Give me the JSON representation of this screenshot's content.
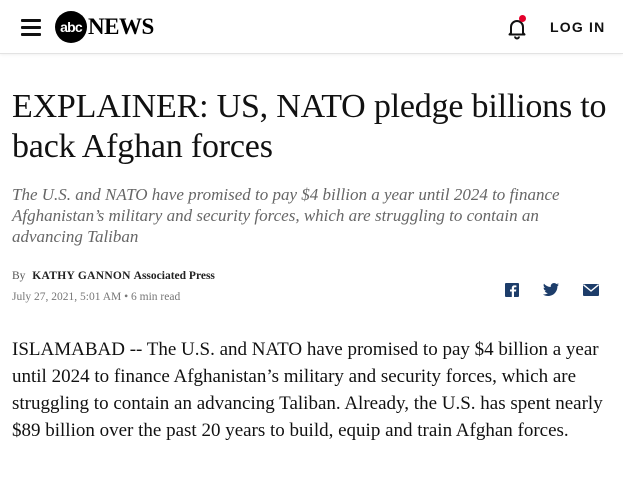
{
  "header": {
    "logo_abc": "abc",
    "logo_news": "NEWS",
    "login_label": "LOG IN",
    "notification_dot_color": "#e4002b"
  },
  "article": {
    "headline": "EXPLAINER: US, NATO pledge billions to back Afghan forces",
    "subhead": "The U.S. and NATO have promised to pay $4 billion a year until 2024 to finance Afghanistan’s military and security forces, which are struggling to contain an advancing Taliban",
    "byline_prefix": "By",
    "author": "KATHY GANNON",
    "outlet": "Associated Press",
    "date": "July 27, 2021, 5:01 AM",
    "read_time": "• 6 min read",
    "share_icons": [
      "facebook-icon",
      "twitter-icon",
      "email-icon"
    ],
    "body": "ISLAMABAD -- The U.S. and NATO have promised to pay $4 billion a year until 2024 to finance Afghanistan’s military and security forces, which are struggling to contain an advancing Taliban. Already, the U.S. has spent nearly $89 billion over the past 20 years to build, equip and train Afghan forces."
  },
  "colors": {
    "share_icon": "#1d3d6a",
    "subhead": "#666666"
  }
}
